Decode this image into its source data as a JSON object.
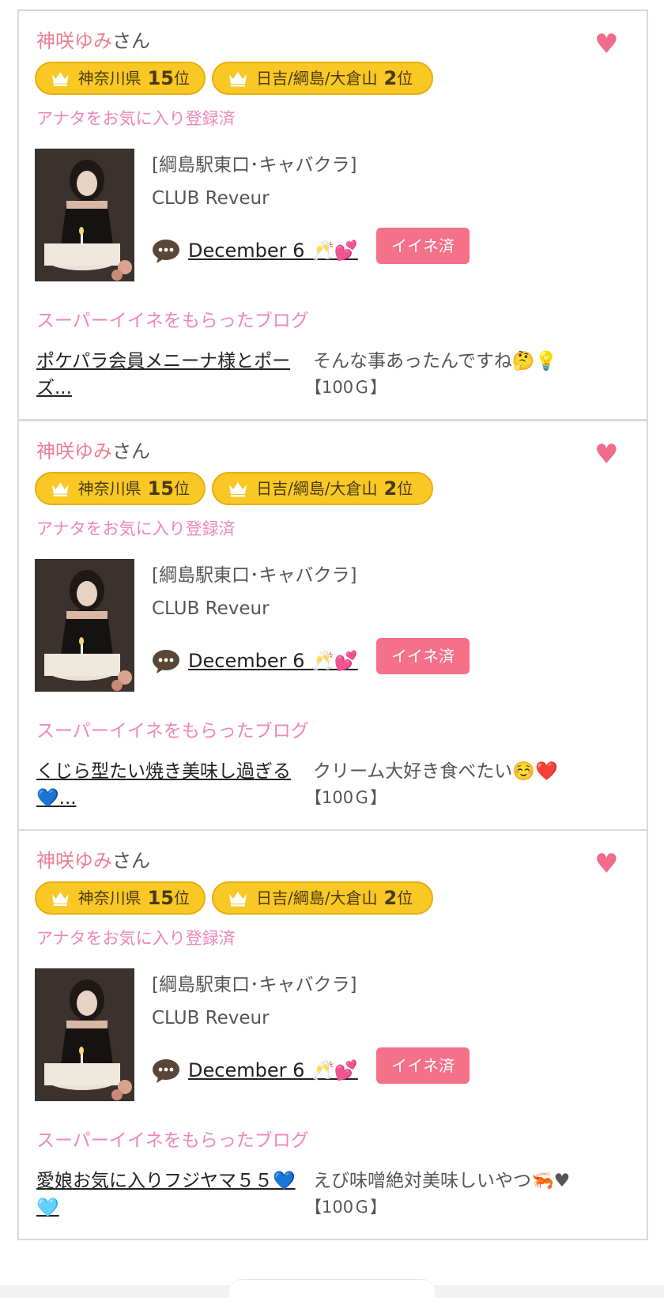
{
  "cards": [
    {
      "cast_name": "神咲ゆみ",
      "honorific": "さん",
      "rank_badges": [
        {
          "area": "神奈川県",
          "rank": "15",
          "suffix": "位"
        },
        {
          "area": "日吉/綱島/大倉山",
          "rank": "2",
          "suffix": "位"
        }
      ],
      "favorite_status": "アナタをお気に入り登録済",
      "shop_category": "[綱島駅東口･キャバクラ]",
      "shop_name": "CLUB Reveur",
      "post_title": "December 6 🥂💕",
      "like_button": "イイネ済",
      "blog_heading": "スーパーイイネをもらったブログ",
      "blog_title": "ポケパラ会員メニーナ様とポーズ...",
      "blog_comment": "そんな事あったんですね🤔💡",
      "points": "【100Ｇ】"
    },
    {
      "cast_name": "神咲ゆみ",
      "honorific": "さん",
      "rank_badges": [
        {
          "area": "神奈川県",
          "rank": "15",
          "suffix": "位"
        },
        {
          "area": "日吉/綱島/大倉山",
          "rank": "2",
          "suffix": "位"
        }
      ],
      "favorite_status": "アナタをお気に入り登録済",
      "shop_category": "[綱島駅東口･キャバクラ]",
      "shop_name": "CLUB Reveur",
      "post_title": "December 6 🥂💕",
      "like_button": "イイネ済",
      "blog_heading": "スーパーイイネをもらったブログ",
      "blog_title": "くじら型たい焼き美味し過ぎる💙...",
      "blog_comment": "クリーム大好き食べたい☺️❤️",
      "points": "【100Ｇ】"
    },
    {
      "cast_name": "神咲ゆみ",
      "honorific": "さん",
      "rank_badges": [
        {
          "area": "神奈川県",
          "rank": "15",
          "suffix": "位"
        },
        {
          "area": "日吉/綱島/大倉山",
          "rank": "2",
          "suffix": "位"
        }
      ],
      "favorite_status": "アナタをお気に入り登録済",
      "shop_category": "[綱島駅東口･キャバクラ]",
      "shop_name": "CLUB Reveur",
      "post_title": "December 6 🥂💕",
      "like_button": "イイネ済",
      "blog_heading": "スーパーイイネをもらったブログ",
      "blog_title": "愛娘お気に入りフジヤマ５５💙🩵",
      "blog_comment": "えび味噌絶対美味しいやつ🦐♥",
      "points": "【100Ｇ】"
    }
  ],
  "icons": {
    "favorite": "heart-icon",
    "badge": "crown-icon",
    "post": "comment-icon"
  },
  "colors": {
    "accent_pink": "#ee86ba",
    "like_button": "#f57089",
    "badge_yellow": "#f9c824",
    "heart": "#f16c8a"
  }
}
